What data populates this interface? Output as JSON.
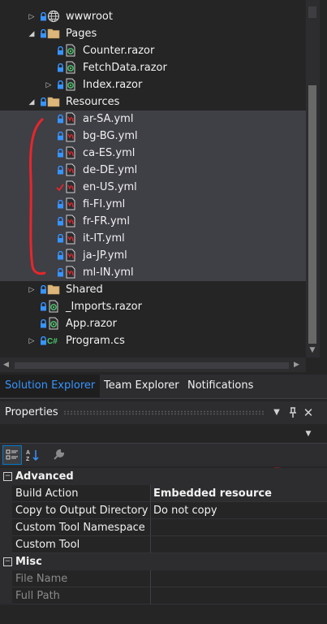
{
  "solution_tree": {
    "items": [
      {
        "label": "wwwroot",
        "icon": "globe-icon",
        "depth": 1,
        "expander": "collapsed",
        "lock": true
      },
      {
        "label": "Pages",
        "icon": "folder-icon",
        "depth": 1,
        "expander": "expanded",
        "lock": true
      },
      {
        "label": "Counter.razor",
        "icon": "razor-file-icon",
        "depth": 2,
        "expander": "none",
        "lock": true
      },
      {
        "label": "FetchData.razor",
        "icon": "razor-file-icon",
        "depth": 2,
        "expander": "none",
        "lock": true
      },
      {
        "label": "Index.razor",
        "icon": "razor-file-icon",
        "depth": 2,
        "expander": "collapsed",
        "lock": true
      },
      {
        "label": "Resources",
        "icon": "folder-icon",
        "depth": 1,
        "expander": "expanded",
        "lock": true
      },
      {
        "label": "ar-SA.yml",
        "icon": "yaml-file-icon",
        "depth": 2,
        "expander": "none",
        "lock": true,
        "selected": true
      },
      {
        "label": "bg-BG.yml",
        "icon": "yaml-file-icon",
        "depth": 2,
        "expander": "none",
        "lock": true,
        "selected": true
      },
      {
        "label": "ca-ES.yml",
        "icon": "yaml-file-icon",
        "depth": 2,
        "expander": "none",
        "lock": true,
        "selected": true
      },
      {
        "label": "de-DE.yml",
        "icon": "yaml-file-icon",
        "depth": 2,
        "expander": "none",
        "lock": true,
        "selected": true
      },
      {
        "label": "en-US.yml",
        "icon": "yaml-file-icon",
        "depth": 2,
        "expander": "none",
        "lock": false,
        "checked": true,
        "selected": true
      },
      {
        "label": "fi-FI.yml",
        "icon": "yaml-file-icon",
        "depth": 2,
        "expander": "none",
        "lock": true,
        "selected": true
      },
      {
        "label": "fr-FR.yml",
        "icon": "yaml-file-icon",
        "depth": 2,
        "expander": "none",
        "lock": true,
        "selected": true
      },
      {
        "label": "it-IT.yml",
        "icon": "yaml-file-icon",
        "depth": 2,
        "expander": "none",
        "lock": true,
        "selected": true
      },
      {
        "label": "ja-JP.yml",
        "icon": "yaml-file-icon",
        "depth": 2,
        "expander": "none",
        "lock": true,
        "selected": true
      },
      {
        "label": "ml-IN.yml",
        "icon": "yaml-file-icon",
        "depth": 2,
        "expander": "none",
        "lock": true,
        "selected": true
      },
      {
        "label": "Shared",
        "icon": "folder-icon",
        "depth": 1,
        "expander": "collapsed",
        "lock": true
      },
      {
        "label": "_Imports.razor",
        "icon": "razor-file-icon",
        "depth": 1,
        "expander": "none",
        "lock": true
      },
      {
        "label": "App.razor",
        "icon": "razor-file-icon",
        "depth": 1,
        "expander": "none",
        "lock": true
      },
      {
        "label": "Program.cs",
        "icon": "csharp-file-icon",
        "depth": 1,
        "expander": "collapsed",
        "lock": true
      }
    ]
  },
  "tabs": [
    {
      "label": "Solution Explorer",
      "active": true
    },
    {
      "label": "Team Explorer",
      "active": false
    },
    {
      "label": "Notifications",
      "active": false
    }
  ],
  "properties": {
    "title": "Properties",
    "categories": [
      {
        "label": "Advanced",
        "rows": [
          {
            "name": "Build Action",
            "value": "Embedded resource",
            "bold": true
          },
          {
            "name": "Copy to Output Directory",
            "value": "Do not copy"
          },
          {
            "name": "Custom Tool Namespace",
            "value": ""
          },
          {
            "name": "Custom Tool",
            "value": ""
          }
        ]
      },
      {
        "label": "Misc",
        "rows": [
          {
            "name": "File Name",
            "value": "",
            "dim": true
          },
          {
            "name": "Full Path",
            "value": "",
            "dim": true
          }
        ]
      }
    ]
  },
  "colors": {
    "background": "#252526",
    "selection": "#3f3f46",
    "active_tab_text": "#3794ff",
    "annotation": "#e8262a"
  }
}
